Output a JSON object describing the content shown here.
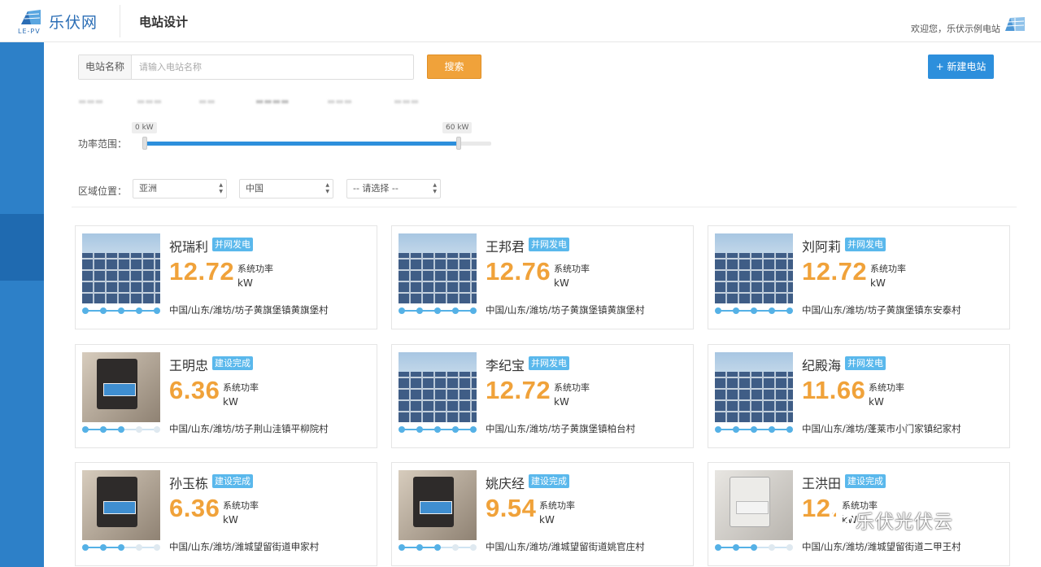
{
  "header": {
    "logo_cn": "乐伏网",
    "logo_en": "LE-PV",
    "title": "电站设计",
    "welcome": "欢迎您，乐伏示例电站"
  },
  "search": {
    "label": "电站名称",
    "placeholder": "请输入电站名称",
    "button": "搜索"
  },
  "new_button": "+ 新建电站",
  "power_range": {
    "label": "功率范围：",
    "min_label": "0 kW",
    "max_label": "60 kW",
    "selected_fraction": 0.9
  },
  "region": {
    "label": "区域位置：",
    "continent": "亚洲",
    "country": "中国",
    "province": "-- 请选择 --"
  },
  "power_text": "系统功率",
  "unit_text": "kW",
  "cards": [
    {
      "owner": "祝瑞利",
      "status": "并网发电",
      "power": "12.72",
      "location": "中国/山东/潍坊/坊子黄旗堡镇黄旗堡村",
      "photo": "solar-panels",
      "progress": 5
    },
    {
      "owner": "王邦君",
      "status": "并网发电",
      "power": "12.76",
      "location": "中国/山东/潍坊/坊子黄旗堡镇黄旗堡村",
      "photo": "solar-panels",
      "progress": 5
    },
    {
      "owner": "刘阿莉",
      "status": "并网发电",
      "power": "12.72",
      "location": "中国/山东/潍坊/坊子黄旗堡镇东安泰村",
      "photo": "solar-panels",
      "progress": 5
    },
    {
      "owner": "王明忠",
      "status": "建设完成",
      "power": "6.36",
      "location": "中国/山东/潍坊/坊子荆山洼镇平柳院村",
      "photo": "inverter",
      "progress": 3
    },
    {
      "owner": "李纪宝",
      "status": "并网发电",
      "power": "12.72",
      "location": "中国/山东/潍坊/坊子黄旗堡镇柏台村",
      "photo": "solar-panels",
      "progress": 5
    },
    {
      "owner": "纪殿海",
      "status": "并网发电",
      "power": "11.66",
      "location": "中国/山东/潍坊/蓬莱市小门家镇纪家村",
      "photo": "solar-panels",
      "progress": 5
    },
    {
      "owner": "孙玉栋",
      "status": "建设完成",
      "power": "6.36",
      "location": "中国/山东/潍坊/潍城望留街道申家村",
      "photo": "inverter",
      "progress": 3
    },
    {
      "owner": "姚庆经",
      "status": "建设完成",
      "power": "9.54",
      "location": "中国/山东/潍坊/潍城望留街道姚官庄村",
      "photo": "inverter",
      "progress": 3
    },
    {
      "owner": "王洪田",
      "status": "建设完成",
      "power": "12.",
      "location": "中国/山东/潍坊/潍城望留街道二甲王村",
      "photo": "inverter-white",
      "progress": 3
    }
  ],
  "watermark": "乐伏光伏云",
  "colors": {
    "sidebar": "#2d80c8",
    "accent_orange": "#f0a23a",
    "accent_blue": "#2d8fdc",
    "badge": "#5ab8ec"
  }
}
